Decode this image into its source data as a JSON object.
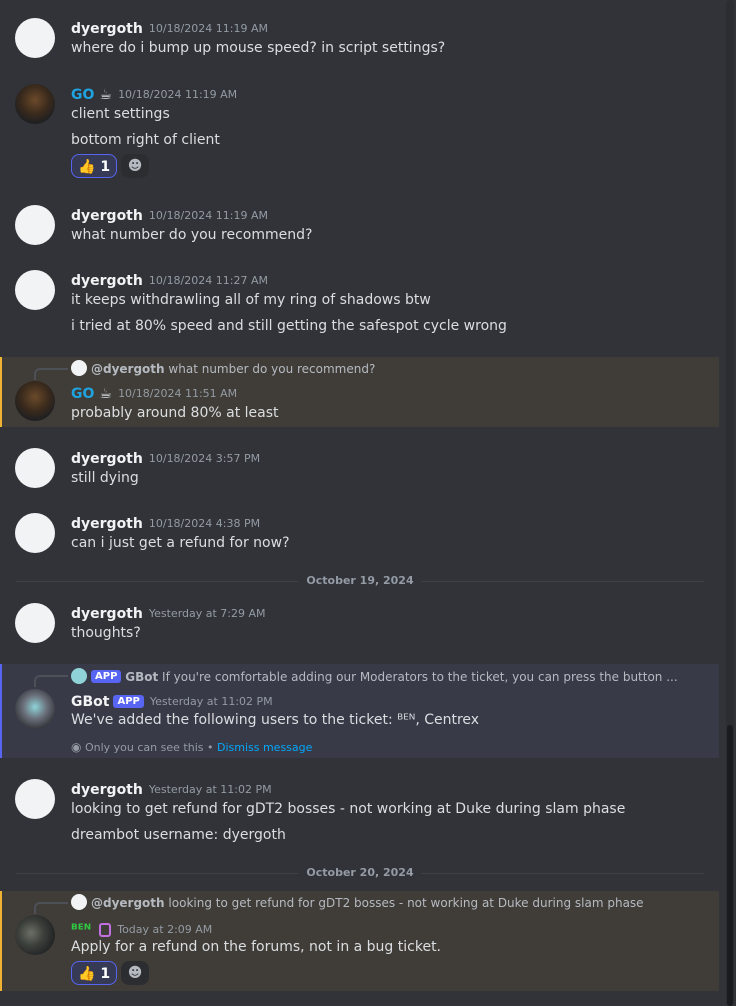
{
  "messages": [
    {
      "author": "dyergoth",
      "time": "10/18/2024 11:19 AM",
      "lines": [
        "where do i bump up mouse speed? in script settings?"
      ]
    },
    {
      "author": "GO",
      "badge": "☕",
      "time": "10/18/2024 11:19 AM",
      "lines": [
        "client settings",
        "bottom right of client"
      ],
      "reaction": {
        "emoji": "👍",
        "count": "1"
      }
    },
    {
      "author": "dyergoth",
      "time": "10/18/2024 11:19 AM",
      "lines": [
        "what number do you recommend?"
      ]
    },
    {
      "author": "dyergoth",
      "time": "10/18/2024 11:27 AM",
      "lines": [
        "it keeps withdrawling all of my ring of shadows btw",
        "i tried at 80% speed and still getting the safespot cycle wrong"
      ]
    },
    {
      "reply": {
        "name": "@dyergoth",
        "text": "what number do you recommend?"
      },
      "author": "GO",
      "badge": "☕",
      "time": "10/18/2024 11:51 AM",
      "lines": [
        "probably around 80% at least"
      ]
    },
    {
      "author": "dyergoth",
      "time": "10/18/2024 3:57 PM",
      "lines": [
        "still dying"
      ]
    },
    {
      "author": "dyergoth",
      "time": "10/18/2024 4:38 PM",
      "lines": [
        "can i just get a refund for now?"
      ]
    },
    {
      "author": "dyergoth",
      "time": "Yesterday at 7:29 AM",
      "lines": [
        "thoughts?"
      ]
    },
    {
      "reply": {
        "app": "APP",
        "name": "GBot",
        "text": "If you're comfortable adding our Moderators to the ticket, you can press the button ..."
      },
      "author": "GBot",
      "app": "APP",
      "time": "Yesterday at 11:02 PM",
      "lines": [
        "We've added the following users to the ticket: ᴮᴱᴺ, Centrex"
      ],
      "note": "Only you can see this • ",
      "note_link": "Dismiss message"
    },
    {
      "author": "dyergoth",
      "time": "Yesterday at 11:02 PM",
      "lines": [
        "looking to get refund for gDT2 bosses - not working at Duke during slam phase",
        "dreambot username: dyergoth"
      ]
    },
    {
      "reply": {
        "name": "@dyergoth",
        "text": "looking to get refund for gDT2 bosses - not working at Duke during slam phase"
      },
      "author": "ᴮᴱᴺ",
      "time": "Today at 2:09 AM",
      "lines": [
        "Apply for a refund on the forums, not in a bug ticket."
      ],
      "reaction": {
        "emoji": "👍",
        "count": "1"
      }
    }
  ],
  "dividers": [
    "October 19, 2024",
    "October 20, 2024"
  ],
  "colors": {
    "accent": "#5865f2",
    "highlight_bar": "#f0b232",
    "go_name": "#1fa3e0"
  }
}
